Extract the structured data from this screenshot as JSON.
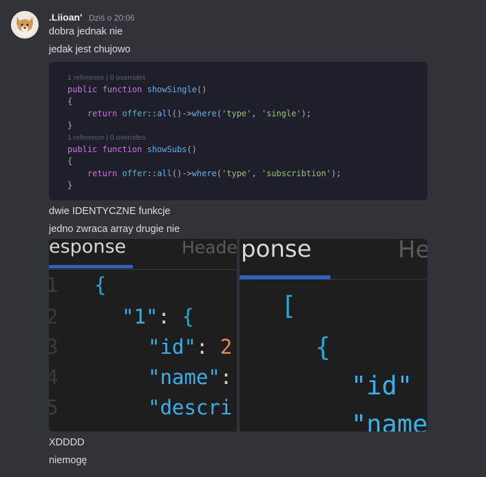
{
  "message": {
    "author": ".Liioan'",
    "timestamp": "Dziś o 20:06",
    "lines": [
      "dobra jednak nie",
      "jedak jest chujowo"
    ],
    "after_code_lines": [
      "dwie IDENTYCZNE funkcje",
      "jedno zwraca array drugie nie"
    ],
    "final_lines": [
      "XDDDD",
      "niemogę"
    ]
  },
  "code_screenshot": {
    "ref_hint": "1 reference | 0 overrides",
    "func1_name": "showSingle",
    "func1_type_value": "single",
    "func2_name": "showSubs",
    "func2_type_value": "subscribtion",
    "model": "offer",
    "method": "all",
    "where": "where",
    "key": "type"
  },
  "json_left": {
    "tab": "esponse",
    "tab2": "Heade",
    "line_numbers": [
      "1",
      "2",
      "3",
      "4",
      "5"
    ],
    "key_1": "\"1\"",
    "key_id": "\"id\"",
    "id_value": "2",
    "key_name": "\"name\"",
    "key_descr": "\"descri"
  },
  "json_right": {
    "tab": "ponse",
    "tab2": "He",
    "open_bracket": "[",
    "open_brace": "{",
    "key_id": "\"id\"",
    "key_name": "\"name"
  }
}
